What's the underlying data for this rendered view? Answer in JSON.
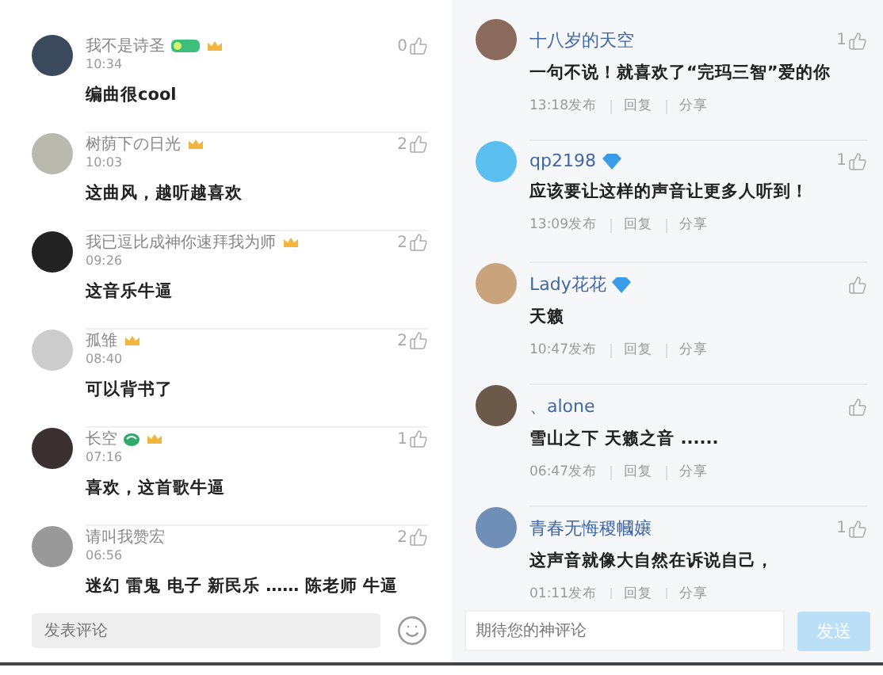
{
  "left_panel": {
    "comments": [
      {
        "name": "我不是诗圣",
        "badges": [
          {
            "kind": "green-tag"
          },
          {
            "kind": "crown"
          }
        ],
        "time": "10:34",
        "text": "编曲很cool",
        "likes": "0"
      },
      {
        "name": "树荫下の日光",
        "badges": [
          {
            "kind": "crown"
          }
        ],
        "time": "10:03",
        "text": "这曲风，越听越喜欢",
        "likes": "2"
      },
      {
        "name": "我已逗比成神你速拜我为师",
        "badges": [
          {
            "kind": "crown"
          }
        ],
        "time": "09:26",
        "text": "这音乐牛逼",
        "likes": "2"
      },
      {
        "name": "孤雏",
        "badges": [
          {
            "kind": "crown"
          }
        ],
        "time": "08:40",
        "text": "可以背书了",
        "likes": "2"
      },
      {
        "name": "长空",
        "badges": [
          {
            "kind": "green-swirl"
          },
          {
            "kind": "crown"
          }
        ],
        "time": "07:16",
        "text": "喜欢，这首歌牛逼",
        "likes": "1"
      },
      {
        "name": "请叫我赞宏",
        "time": "06:56",
        "text": "迷幻 雷鬼 电子 新民乐 …… 陈老师 牛逼",
        "likes": "2"
      }
    ],
    "input": {
      "placeholder": "发表评论"
    }
  },
  "right_panel": {
    "comments": [
      {
        "name": "十八岁的天空",
        "text": "一句不说！就喜欢了“完玛三智”爱的你",
        "time": "13:18发布",
        "reply": "回复",
        "share": "分享",
        "likes": "1"
      },
      {
        "name": "qp2198",
        "badges": [
          {
            "kind": "diamond"
          }
        ],
        "text": "应该要让这样的声音让更多人听到！",
        "time": "13:09发布",
        "reply": "回复",
        "share": "分享",
        "likes": "1"
      },
      {
        "name": "Lady花花",
        "badges": [
          {
            "kind": "diamond"
          }
        ],
        "text": "天籁",
        "time": "10:47发布",
        "reply": "回复",
        "share": "分享"
      },
      {
        "name": "、alone",
        "text": "雪山之下 天籁之音 ......",
        "time": "06:47发布",
        "reply": "回复",
        "share": "分享"
      },
      {
        "name": "青春无悔稷幗孃",
        "text": "这声音就像大自然在诉说自己，",
        "time": "01:11发布",
        "reply": "回复",
        "share": "分享",
        "likes": "1"
      }
    ],
    "input": {
      "placeholder": "期待您的神评论"
    },
    "send_button": {
      "label": "发送",
      "disabled": true
    }
  }
}
